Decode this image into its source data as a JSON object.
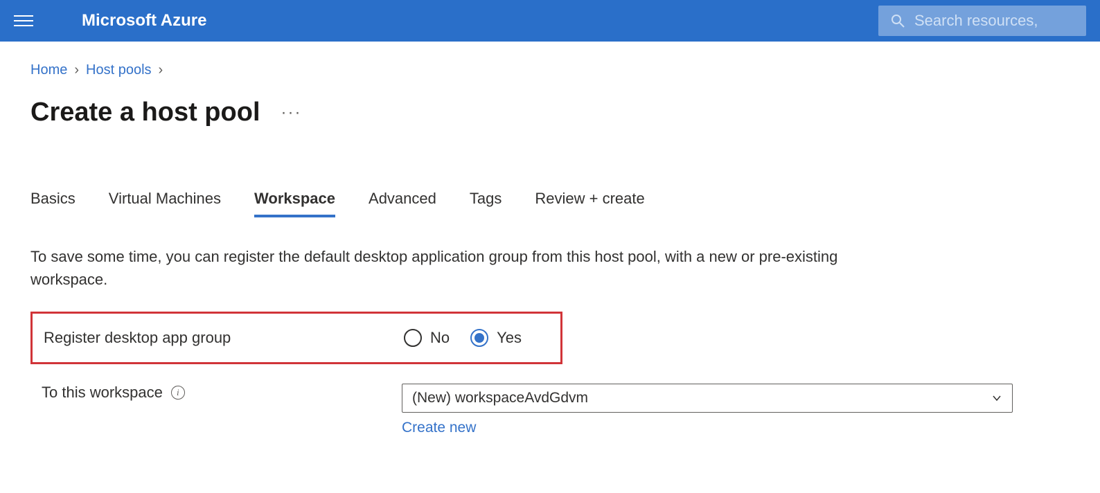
{
  "header": {
    "brand": "Microsoft Azure",
    "search_placeholder": "Search resources,"
  },
  "breadcrumb": {
    "items": [
      "Home",
      "Host pools"
    ]
  },
  "page": {
    "title": "Create a host pool"
  },
  "tabs": {
    "items": [
      {
        "label": "Basics",
        "active": false
      },
      {
        "label": "Virtual Machines",
        "active": false
      },
      {
        "label": "Workspace",
        "active": true
      },
      {
        "label": "Advanced",
        "active": false
      },
      {
        "label": "Tags",
        "active": false
      },
      {
        "label": "Review + create",
        "active": false
      }
    ]
  },
  "workspace": {
    "description": "To save some time, you can register the default desktop application group from this host pool, with a new or pre-existing workspace.",
    "register_label": "Register desktop app group",
    "option_no": "No",
    "option_yes": "Yes",
    "selected": "Yes",
    "to_workspace_label": "To this workspace",
    "workspace_value": "(New) workspaceAvdGdvm",
    "create_new_label": "Create new"
  }
}
